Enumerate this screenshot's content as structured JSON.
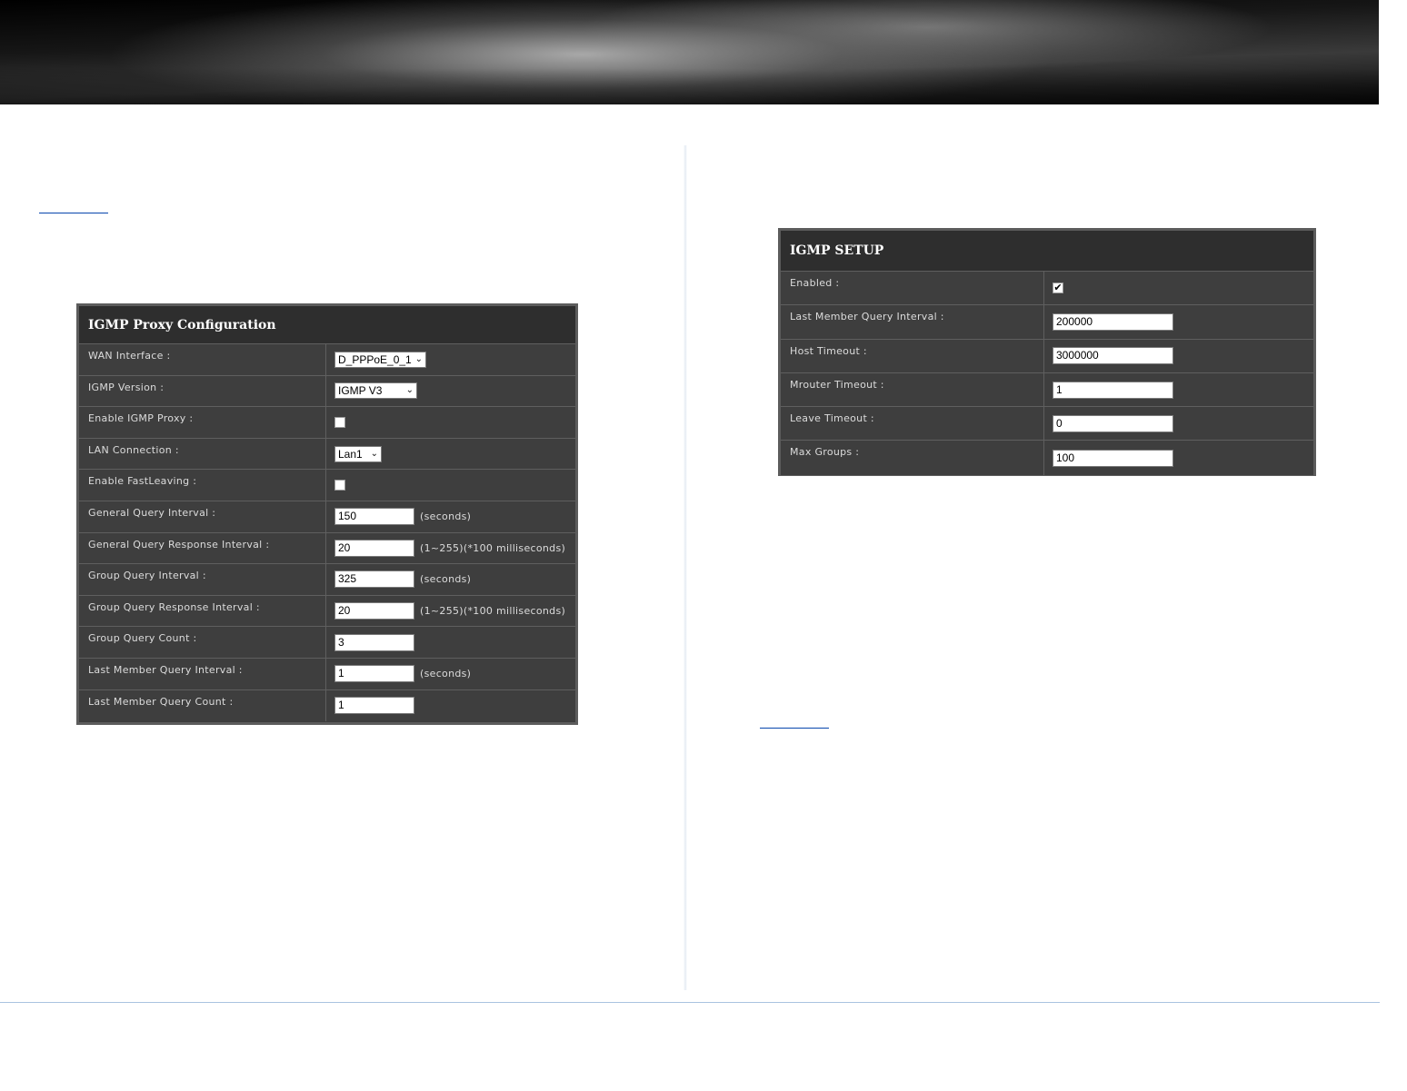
{
  "proxy_config": {
    "title": "IGMP Proxy Configuration",
    "rows": [
      {
        "label": "WAN Interface :",
        "kind": "select",
        "value": "D_PPPoE_0_1"
      },
      {
        "label": "IGMP Version :",
        "kind": "select",
        "value": "IGMP V3"
      },
      {
        "label": "Enable IGMP Proxy :",
        "kind": "checkbox",
        "checked": false
      },
      {
        "label": "LAN Connection :",
        "kind": "select",
        "value": "Lan1"
      },
      {
        "label": "Enable FastLeaving :",
        "kind": "checkbox",
        "checked": false
      },
      {
        "label": "General Query Interval :",
        "kind": "input",
        "value": "150",
        "unit": "(seconds)"
      },
      {
        "label": "General Query Response Interval :",
        "kind": "input",
        "value": "20",
        "unit": "(1~255)(*100 milliseconds)"
      },
      {
        "label": "Group Query Interval :",
        "kind": "input",
        "value": "325",
        "unit": "(seconds)"
      },
      {
        "label": "Group Query Response Interval :",
        "kind": "input",
        "value": "20",
        "unit": "(1~255)(*100 milliseconds)"
      },
      {
        "label": "Group Query Count :",
        "kind": "input",
        "value": "3",
        "unit": ""
      },
      {
        "label": "Last Member Query Interval :",
        "kind": "input",
        "value": "1",
        "unit": "(seconds)"
      },
      {
        "label": "Last Member Query Count :",
        "kind": "input",
        "value": "1",
        "unit": ""
      }
    ]
  },
  "igmp_setup": {
    "title": "IGMP SETUP",
    "rows": [
      {
        "label": "Enabled :",
        "kind": "checkbox",
        "checked": true
      },
      {
        "label": "Last Member Query Interval :",
        "kind": "input",
        "value": "200000"
      },
      {
        "label": "Host Timeout :",
        "kind": "input",
        "value": "3000000"
      },
      {
        "label": "Mrouter Timeout :",
        "kind": "input",
        "value": "1"
      },
      {
        "label": "Leave Timeout :",
        "kind": "input",
        "value": "0"
      },
      {
        "label": "Max Groups :",
        "kind": "input",
        "value": "100"
      }
    ]
  },
  "icons": {
    "dropdown": "chevron-down-icon",
    "checkmark": "checkmark-icon",
    "chevron_glyph": "⌄",
    "check_glyph": "✔"
  },
  "colors": {
    "panel_bg": "#3e3e3e",
    "panel_title_bg": "#2e2e2e",
    "panel_border": "#5c5c5c",
    "label_text": "#dcdcdc",
    "footer_rule": "#a9c3e0",
    "link": "#0645ad"
  }
}
